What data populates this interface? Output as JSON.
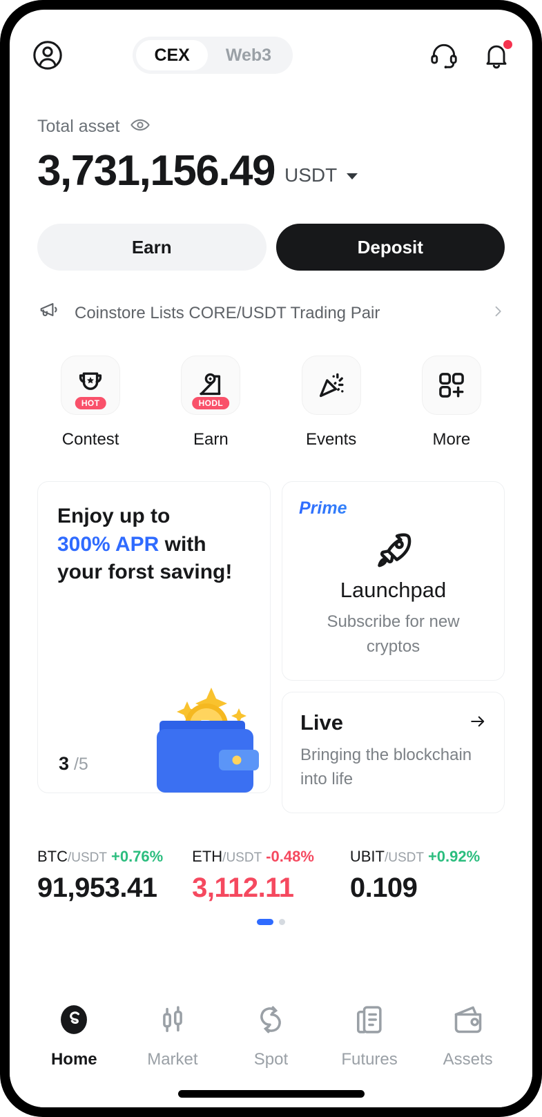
{
  "header": {
    "avatar_icon": "user-circle-icon",
    "tabs": [
      {
        "label": "CEX",
        "active": true
      },
      {
        "label": "Web3",
        "active": false
      }
    ],
    "support_icon": "headset-icon",
    "notification_icon": "bell-icon",
    "has_notification": true
  },
  "balance": {
    "label": "Total asset",
    "eye_icon": "eye-icon",
    "amount": "3,731,156.49",
    "currency": "USDT"
  },
  "actions": {
    "earn_label": "Earn",
    "deposit_label": "Deposit"
  },
  "announcement": {
    "icon": "megaphone-icon",
    "text": "Coinstore Lists CORE/USDT Trading Pair",
    "chevron": "chevron-right-icon"
  },
  "quick_actions": [
    {
      "label": "Contest",
      "icon": "trophy-icon",
      "badge": "HOT"
    },
    {
      "label": "Earn",
      "icon": "hodl-hand-icon",
      "badge": "HODL"
    },
    {
      "label": "Events",
      "icon": "party-popper-icon",
      "badge": ""
    },
    {
      "label": "More",
      "icon": "grid-plus-icon",
      "badge": ""
    }
  ],
  "promo_card": {
    "line1": "Enjoy up to",
    "accent": "300% APR",
    "line2_tail": " with",
    "line3": "your forst saving!",
    "accent_color": "#2f6bff",
    "current": "3",
    "total": "/5",
    "art": "wallet-bitcoin-illustration"
  },
  "launchpad_card": {
    "badge": "Prime",
    "icon": "rocket-icon",
    "title": "Launchpad",
    "subtitle": "Subscribe for new cryptos"
  },
  "live_card": {
    "title": "Live",
    "arrow_icon": "arrow-right-icon",
    "subtitle": "Bringing the blockchain into life"
  },
  "tickers": [
    {
      "base": "BTC",
      "quote": "/USDT",
      "change": "+0.76%",
      "direction": "up",
      "price": "91,953.41"
    },
    {
      "base": "ETH",
      "quote": "/USDT",
      "change": "-0.48%",
      "direction": "down",
      "price": "3,112.11"
    },
    {
      "base": "UBIT",
      "quote": "/USDT",
      "change": "+0.92%",
      "direction": "up",
      "price": "0.109"
    }
  ],
  "ticker_pager": {
    "pages": 2,
    "active": 0
  },
  "bottom_nav": [
    {
      "label": "Home",
      "icon": "home-logo-icon",
      "active": true
    },
    {
      "label": "Market",
      "icon": "candlestick-icon",
      "active": false
    },
    {
      "label": "Spot",
      "icon": "swap-circles-icon",
      "active": false
    },
    {
      "label": "Futures",
      "icon": "chart-doc-icon",
      "active": false
    },
    {
      "label": "Assets",
      "icon": "wallet-icon",
      "active": false
    }
  ],
  "colors": {
    "up": "#2bbd7e",
    "down": "#f5495f",
    "accent_blue": "#2f6bff",
    "badge_red": "#f9516a",
    "ink": "#17181a"
  }
}
